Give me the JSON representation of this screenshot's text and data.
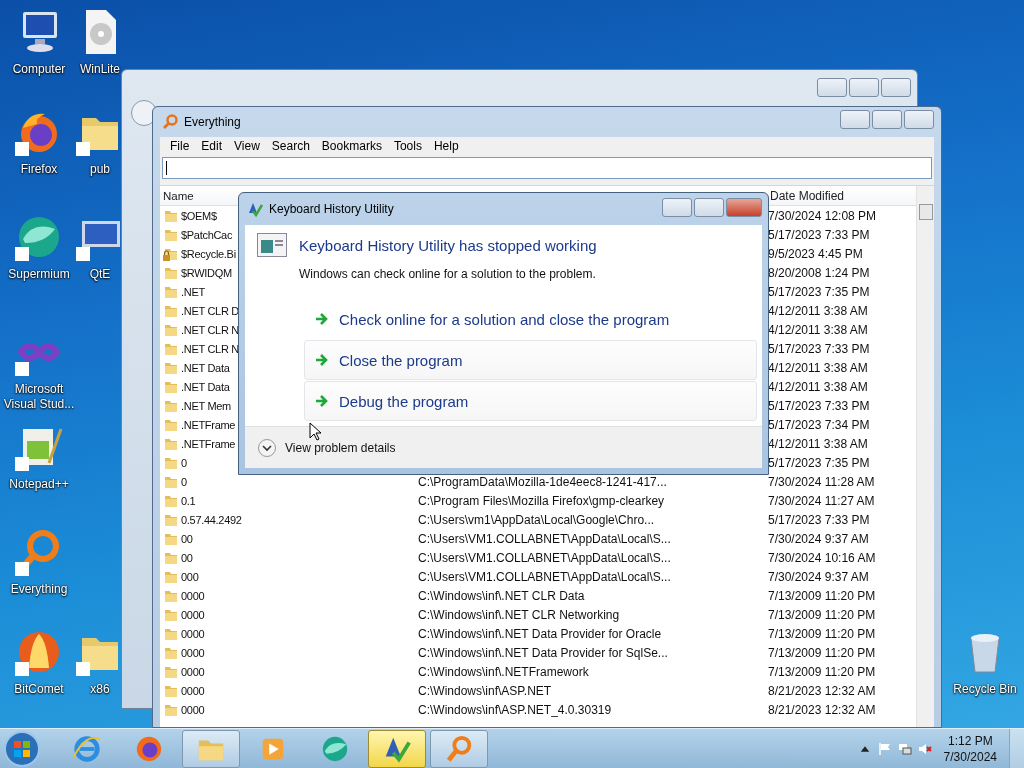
{
  "desktop_icons": [
    {
      "label": "Computer",
      "kind": "computer"
    },
    {
      "label": "WinLite",
      "kind": "disc"
    },
    {
      "label": "Firefox",
      "kind": "firefox"
    },
    {
      "label": "pub",
      "kind": "folder"
    },
    {
      "label": "Supermium",
      "kind": "supermium"
    },
    {
      "label": "QtE",
      "kind": "monitor"
    },
    {
      "label": "Microsoft Visual Stud...",
      "kind": "infinity"
    },
    {
      "label": "Notepad++",
      "kind": "notepad"
    },
    {
      "label": "Everything",
      "kind": "magnifier"
    },
    {
      "label": "BitComet",
      "kind": "comet"
    },
    {
      "label": "x86",
      "kind": "folder"
    },
    {
      "label": "Recycle Bin",
      "kind": "bin"
    }
  ],
  "everything_window": {
    "title": "Everything",
    "menu": [
      "File",
      "Edit",
      "View",
      "Search",
      "Bookmarks",
      "Tools",
      "Help"
    ],
    "columns": [
      {
        "label": "Name"
      },
      {
        "label": "Date Modified"
      }
    ],
    "rows": [
      {
        "name": "$OEM$",
        "date_modified": "7/30/2024 12:08 PM",
        "locked": false
      },
      {
        "name": "$PatchCac",
        "date_modified": "5/17/2023 7:33 PM",
        "locked": false
      },
      {
        "name": "$Recycle.Bi",
        "date_modified": "9/5/2023 4:45 PM",
        "locked": true
      },
      {
        "name": "$RWIDQM",
        "date_modified": "8/20/2008 1:24 PM",
        "locked": false
      },
      {
        "name": ".NET",
        "date_modified": "5/17/2023 7:35 PM",
        "locked": false
      },
      {
        "name": ".NET CLR D",
        "date_modified": "4/12/2011 3:38 AM",
        "locked": false
      },
      {
        "name": ".NET CLR N",
        "date_modified": "4/12/2011 3:38 AM",
        "locked": false
      },
      {
        "name": ".NET CLR N",
        "date_modified": "5/17/2023 7:33 PM",
        "locked": false
      },
      {
        "name": ".NET Data",
        "date_modified": "4/12/2011 3:38 AM",
        "locked": false
      },
      {
        "name": ".NET Data",
        "date_modified": "4/12/2011 3:38 AM",
        "locked": false
      },
      {
        "name": ".NET Mem",
        "date_modified": "5/17/2023 7:33 PM",
        "locked": false
      },
      {
        "name": ".NETFrame",
        "date_modified": "5/17/2023 7:34 PM",
        "locked": false
      },
      {
        "name": ".NETFrame",
        "date_modified": "4/12/2011 3:38 AM",
        "locked": false
      },
      {
        "name": "0",
        "date_modified": "5/17/2023 7:35 PM",
        "locked": false
      },
      {
        "name": "0",
        "path": "C:\\ProgramData\\Mozilla-1de4eec8-1241-417...",
        "date_modified": "7/30/2024 11:28 AM",
        "locked": false
      },
      {
        "name": "0.1",
        "path": "C:\\Program Files\\Mozilla Firefox\\gmp-clearkey",
        "date_modified": "7/30/2024 11:27 AM",
        "locked": false
      },
      {
        "name": "0.57.44.2492",
        "path": "C:\\Users\\vm1\\AppData\\Local\\Google\\Chro...",
        "date_modified": "5/17/2023 7:33 PM",
        "locked": false
      },
      {
        "name": "00",
        "path": "C:\\Users\\VM1.COLLABNET\\AppData\\Local\\S...",
        "date_modified": "7/30/2024 9:37 AM",
        "locked": false
      },
      {
        "name": "00",
        "path": "C:\\Users\\VM1.COLLABNET\\AppData\\Local\\S...",
        "date_modified": "7/30/2024 10:16 AM",
        "locked": false
      },
      {
        "name": "000",
        "path": "C:\\Users\\VM1.COLLABNET\\AppData\\Local\\S...",
        "date_modified": "7/30/2024 9:37 AM",
        "locked": false
      },
      {
        "name": "0000",
        "path": "C:\\Windows\\inf\\.NET CLR Data",
        "date_modified": "7/13/2009 11:20 PM",
        "locked": false
      },
      {
        "name": "0000",
        "path": "C:\\Windows\\inf\\.NET CLR Networking",
        "date_modified": "7/13/2009 11:20 PM",
        "locked": false
      },
      {
        "name": "0000",
        "path": "C:\\Windows\\inf\\.NET Data Provider for Oracle",
        "date_modified": "7/13/2009 11:20 PM",
        "locked": false
      },
      {
        "name": "0000",
        "path": "C:\\Windows\\inf\\.NET Data Provider for SqlSe...",
        "date_modified": "7/13/2009 11:20 PM",
        "locked": false
      },
      {
        "name": "0000",
        "path": "C:\\Windows\\inf\\.NETFramework",
        "date_modified": "7/13/2009 11:20 PM",
        "locked": false
      },
      {
        "name": "0000",
        "path": "C:\\Windows\\inf\\ASP.NET",
        "date_modified": "8/21/2023 12:32 AM",
        "locked": false
      },
      {
        "name": "0000",
        "path": "C:\\Windows\\inf\\ASP.NET_4.0.30319",
        "date_modified": "8/21/2023 12:32 AM",
        "locked": false
      }
    ]
  },
  "error_dialog": {
    "title": "Keyboard History Utility",
    "heading": "Keyboard History Utility has stopped working",
    "message": "Windows can check online for a solution to the problem.",
    "options": [
      {
        "label": "Check online for a solution and close the program",
        "highlighted": false
      },
      {
        "label": "Close the program",
        "highlighted": true
      },
      {
        "label": "Debug the program",
        "highlighted": true
      }
    ],
    "details_link": "View problem details"
  },
  "taskbar": {
    "buttons": [
      {
        "kind": "ie",
        "running": false,
        "active": false
      },
      {
        "kind": "firefox",
        "running": false,
        "active": false
      },
      {
        "kind": "explorer",
        "running": true,
        "active": false
      },
      {
        "kind": "media",
        "running": false,
        "active": false
      },
      {
        "kind": "supermium",
        "running": false,
        "active": false
      },
      {
        "kind": "warning",
        "running": true,
        "active": true
      },
      {
        "kind": "magnifier",
        "running": true,
        "active": false
      }
    ],
    "clock": {
      "time": "1:12 PM",
      "date": "7/30/2024"
    }
  }
}
